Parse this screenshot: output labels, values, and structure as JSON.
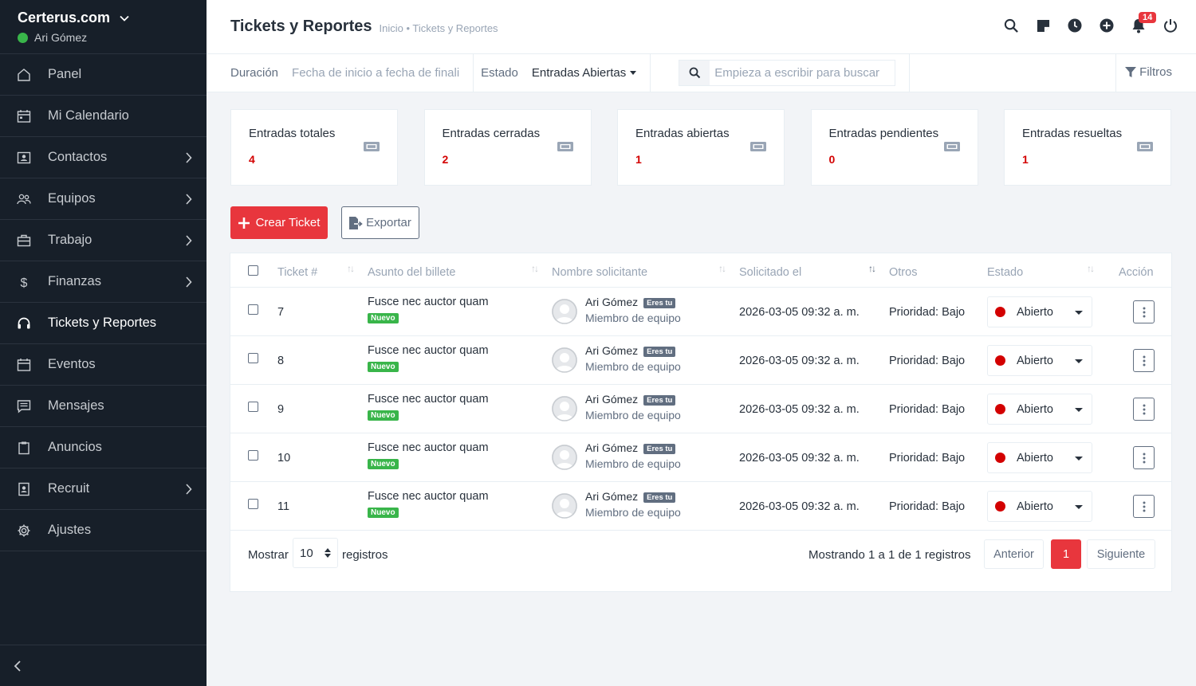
{
  "sidebar": {
    "company": "Certerus.com",
    "user": "Ari Gómez",
    "items": [
      {
        "label": "Panel",
        "icon": "home-icon",
        "arrow": false,
        "active": false
      },
      {
        "label": "Mi Calendario",
        "icon": "calendar-icon",
        "arrow": false,
        "active": false
      },
      {
        "label": "Contactos",
        "icon": "contact-card-icon",
        "arrow": true,
        "active": false
      },
      {
        "label": "Equipos",
        "icon": "people-icon",
        "arrow": true,
        "active": false
      },
      {
        "label": "Trabajo",
        "icon": "briefcase-icon",
        "arrow": true,
        "active": false
      },
      {
        "label": "Finanzas",
        "icon": "dollar-icon",
        "arrow": true,
        "active": false
      },
      {
        "label": "Tickets y Reportes",
        "icon": "headset-icon",
        "arrow": false,
        "active": true
      },
      {
        "label": "Eventos",
        "icon": "event-calendar-icon",
        "arrow": false,
        "active": false
      },
      {
        "label": "Mensajes",
        "icon": "message-icon",
        "arrow": false,
        "active": false
      },
      {
        "label": "Anuncios",
        "icon": "clipboard-icon",
        "arrow": false,
        "active": false
      },
      {
        "label": "Recruit",
        "icon": "id-badge-icon",
        "arrow": true,
        "active": false
      },
      {
        "label": "Ajustes",
        "icon": "gear-icon",
        "arrow": false,
        "active": false
      }
    ]
  },
  "header": {
    "title": "Tickets y Reportes",
    "breadcrumb": "Inicio • Tickets y Reportes",
    "notification_count": "14"
  },
  "filters": {
    "duration_label": "Duración",
    "date_range": "Fecha de inicio a fecha de finali",
    "status_label": "Estado",
    "status_value": "Entradas Abiertas",
    "search_placeholder": "Empieza a escribir para buscar",
    "filters_label": "Filtros"
  },
  "cards": [
    {
      "label": "Entradas totales",
      "value": "4"
    },
    {
      "label": "Entradas cerradas",
      "value": "2"
    },
    {
      "label": "Entradas abiertas",
      "value": "1"
    },
    {
      "label": "Entradas pendientes",
      "value": "0"
    },
    {
      "label": "Entradas resueltas",
      "value": "1"
    }
  ],
  "actions": {
    "create": "Crear Ticket",
    "export": "Exportar"
  },
  "table": {
    "columns": {
      "ticket": "Ticket #",
      "subject": "Asunto del billete",
      "requester": "Nombre solicitante",
      "requested_on": "Solicitado el",
      "others": "Otros",
      "status": "Estado",
      "action": "Acción"
    },
    "rows": [
      {
        "id": "7",
        "subject": "Fusce nec auctor quam",
        "tag": "Nuevo",
        "name": "Ari Gómez",
        "you": "Eres tu",
        "role": "Miembro de equipo",
        "date": "2026-03-05 09:32 a. m.",
        "priority": "Prioridad: Bajo",
        "status": "Abierto"
      },
      {
        "id": "8",
        "subject": "Fusce nec auctor quam",
        "tag": "Nuevo",
        "name": "Ari Gómez",
        "you": "Eres tu",
        "role": "Miembro de equipo",
        "date": "2026-03-05 09:32 a. m.",
        "priority": "Prioridad: Bajo",
        "status": "Abierto"
      },
      {
        "id": "9",
        "subject": "Fusce nec auctor quam",
        "tag": "Nuevo",
        "name": "Ari Gómez",
        "you": "Eres tu",
        "role": "Miembro de equipo",
        "date": "2026-03-05 09:32 a. m.",
        "priority": "Prioridad: Bajo",
        "status": "Abierto"
      },
      {
        "id": "10",
        "subject": "Fusce nec auctor quam",
        "tag": "Nuevo",
        "name": "Ari Gómez",
        "you": "Eres tu",
        "role": "Miembro de equipo",
        "date": "2026-03-05 09:32 a. m.",
        "priority": "Prioridad: Bajo",
        "status": "Abierto"
      },
      {
        "id": "11",
        "subject": "Fusce nec auctor quam",
        "tag": "Nuevo",
        "name": "Ari Gómez",
        "you": "Eres tu",
        "role": "Miembro de equipo",
        "date": "2026-03-05 09:32 a. m.",
        "priority": "Prioridad: Bajo",
        "status": "Abierto"
      }
    ]
  },
  "footer": {
    "show_label": "Mostrar",
    "per_page": "10",
    "records_label": "registros",
    "showing": "Mostrando 1 a 1 de 1 registros",
    "prev": "Anterior",
    "page": "1",
    "next": "Siguiente"
  },
  "colors": {
    "accent": "#e8363d",
    "sidebar_bg": "#171f29",
    "success": "#39b54a",
    "status_open": "#d30000"
  }
}
